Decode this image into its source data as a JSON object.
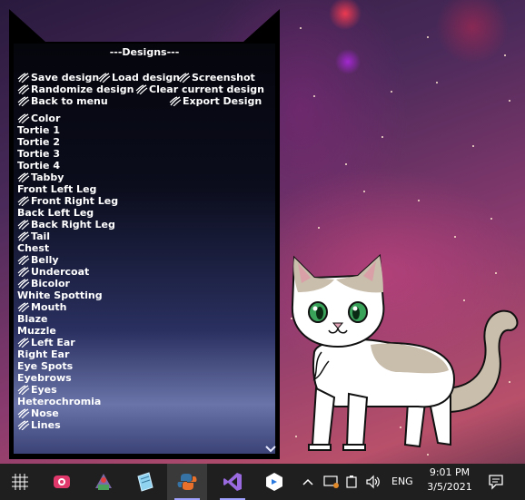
{
  "menu": {
    "title": "---Designs---",
    "actions": {
      "save_design": "Save design",
      "load_design": "Load design",
      "screenshot": "Screenshot",
      "randomize_design": "Randomize design",
      "clear_current_design": "Clear current design",
      "back_to_menu": "Back to menu",
      "export_design": "Export Design"
    },
    "items": [
      {
        "label": "Color",
        "claw": true
      },
      {
        "label": "Tortie 1",
        "claw": false
      },
      {
        "label": "Tortie 2",
        "claw": false
      },
      {
        "label": "Tortie 3",
        "claw": false
      },
      {
        "label": "Tortie 4",
        "claw": false
      },
      {
        "label": "Tabby",
        "claw": true
      },
      {
        "label": "Front Left Leg",
        "claw": false
      },
      {
        "label": "Front Right Leg",
        "claw": true
      },
      {
        "label": "Back Left Leg",
        "claw": false
      },
      {
        "label": "Back Right Leg",
        "claw": true
      },
      {
        "label": "Tail",
        "claw": true
      },
      {
        "label": "Chest",
        "claw": false
      },
      {
        "label": "Belly",
        "claw": true
      },
      {
        "label": "Undercoat",
        "claw": true
      },
      {
        "label": "Bicolor",
        "claw": true
      },
      {
        "label": "White Spotting",
        "claw": false
      },
      {
        "label": "Mouth",
        "claw": true
      },
      {
        "label": "Blaze",
        "claw": false
      },
      {
        "label": "Muzzle",
        "claw": false
      },
      {
        "label": "Left Ear",
        "claw": true
      },
      {
        "label": "Right Ear",
        "claw": false
      },
      {
        "label": "Eye Spots",
        "claw": false
      },
      {
        "label": "Eyebrows",
        "claw": false
      },
      {
        "label": "Eyes",
        "claw": true
      },
      {
        "label": "Heterochromia",
        "claw": false
      },
      {
        "label": "Nose",
        "claw": true
      },
      {
        "label": "Lines",
        "claw": true
      }
    ]
  },
  "colors": {
    "panel_frame": "#000000",
    "cat_fur_white": "#ffffff",
    "cat_fur_tan": "#c9bdab",
    "cat_eye": "#3aa35a",
    "taskbar": "#1f1f1f"
  },
  "taskbar": {
    "apps": [
      {
        "name": "start-grid-icon"
      },
      {
        "name": "camera-app-icon"
      },
      {
        "name": "game-app-icon"
      },
      {
        "name": "notepad-app-icon"
      },
      {
        "name": "python-app-icon",
        "active": true
      },
      {
        "name": "visual-studio-icon",
        "running": true
      },
      {
        "name": "dev-tool-app-icon"
      }
    ],
    "tray": {
      "language": "ENG",
      "time": "9:01 PM",
      "date": "3/5/2021"
    }
  }
}
